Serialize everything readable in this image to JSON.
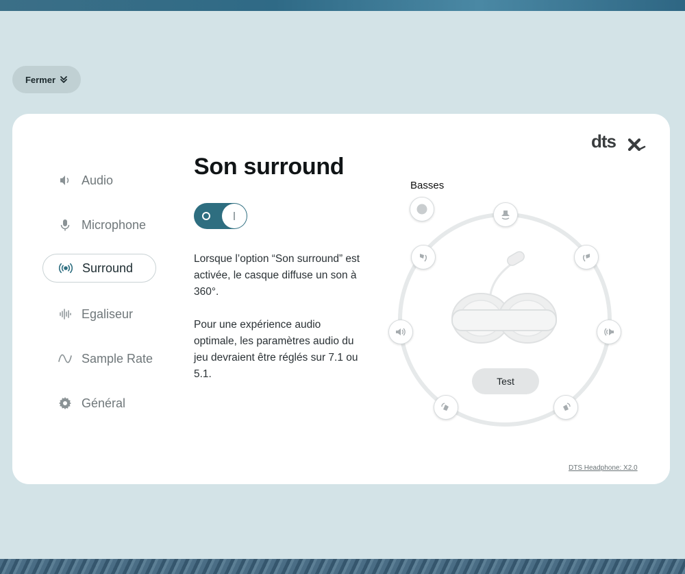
{
  "close_button": {
    "label": "Fermer",
    "icon": "chevron-double-down-icon"
  },
  "brand": {
    "logo_text": "dtsx"
  },
  "nav": {
    "items": [
      {
        "label": "Audio",
        "icon": "speaker-icon",
        "active": false
      },
      {
        "label": "Microphone",
        "icon": "microphone-icon",
        "active": false
      },
      {
        "label": "Surround",
        "icon": "surround-icon",
        "active": true
      },
      {
        "label": "Egaliseur",
        "icon": "equalizer-icon",
        "active": false
      },
      {
        "label": "Sample Rate",
        "icon": "wave-icon",
        "active": false
      },
      {
        "label": "Général",
        "icon": "gear-icon",
        "active": false
      }
    ]
  },
  "main": {
    "title": "Son surround",
    "toggle": {
      "state": "on"
    },
    "description": [
      "Lorsque l’option “Son surround” est activée, le casque diffuse un son à 360°.",
      "Pour une expérience audio optimale, les paramètres audio du jeu devraient être réglés sur 7.1 ou 5.1."
    ]
  },
  "speakers": {
    "basses_label": "Basses",
    "test_label": "Test"
  },
  "footer": {
    "link": "DTS Headphone: X2.0"
  },
  "colors": {
    "accent": "#2e6e80",
    "panel": "#ffffff",
    "background": "#d3e3e7"
  }
}
